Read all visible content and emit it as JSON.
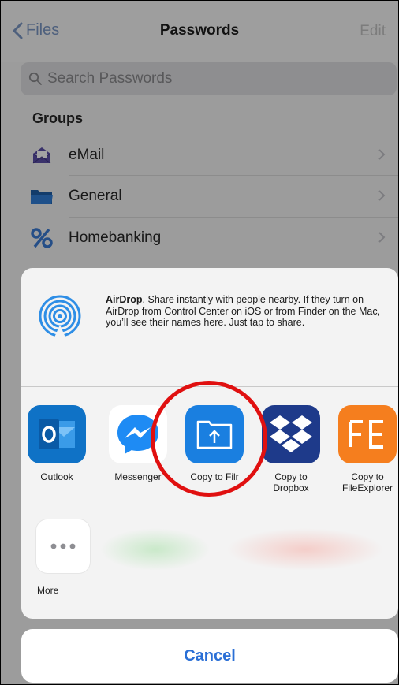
{
  "nav": {
    "back_label": "Files",
    "title": "Passwords",
    "edit_label": "Edit"
  },
  "search": {
    "placeholder": "Search Passwords"
  },
  "groups": {
    "header": "Groups",
    "items": [
      {
        "label": "eMail",
        "icon": "envelope-icon"
      },
      {
        "label": "General",
        "icon": "folder-icon"
      },
      {
        "label": "Homebanking",
        "icon": "percent-icon"
      }
    ]
  },
  "share_sheet": {
    "airdrop": {
      "title": "AirDrop",
      "description": ". Share instantly with people nearby. If they turn on AirDrop from Control Center on iOS or from Finder on the Mac, you’ll see their names here. Just tap to share."
    },
    "apps": [
      {
        "label": "Outlook",
        "icon": "outlook-icon",
        "color": "#0f72c6"
      },
      {
        "label": "Messenger",
        "icon": "messenger-icon",
        "color": "#1e8bf4"
      },
      {
        "label": "Copy to Filr",
        "icon": "filr-icon",
        "color": "#1a7fe0"
      },
      {
        "label": "Copy to\nDropbox",
        "icon": "dropbox-icon",
        "color": "#1e3a8a"
      },
      {
        "label": "Copy to\nFileExplorer",
        "icon": "fileexplorer-icon",
        "color": "#f57e1e"
      }
    ],
    "more": {
      "label": "More",
      "icon": "more-icon"
    }
  },
  "cancel_label": "Cancel",
  "colors": {
    "accent": "#2a6fd6",
    "highlight": "#e01010"
  }
}
